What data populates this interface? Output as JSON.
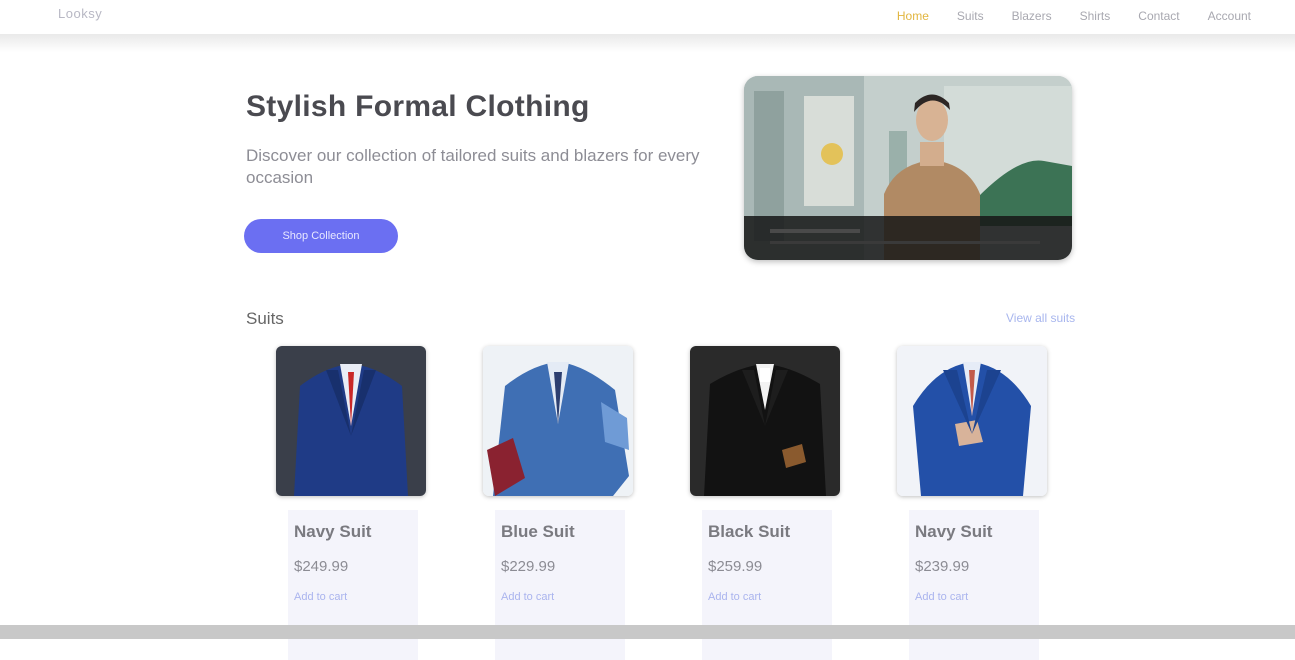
{
  "header": {
    "logo": "Looksy",
    "nav": [
      {
        "label": "Home",
        "active": true
      },
      {
        "label": "Suits",
        "active": false
      },
      {
        "label": "Blazers",
        "active": false
      },
      {
        "label": "Shirts",
        "active": false
      },
      {
        "label": "Contact",
        "active": false
      },
      {
        "label": "Account",
        "active": false
      }
    ],
    "accent_color": "#e2b640"
  },
  "hero": {
    "title": "Stylish Formal Clothing",
    "subtitle": "Discover our collection of tailored suits and blazers for every occasion",
    "cta_label": "Shop Collection",
    "cta_color": "#6b6ff2",
    "video_icon": "play-video-icon"
  },
  "featured": {
    "title": "Suits",
    "view_all": "View all suits",
    "products": [
      {
        "name": "Navy Suit",
        "price": "$249.99",
        "action": "Add to cart",
        "color": "#1f3b86"
      },
      {
        "name": "Blue Suit",
        "price": "$229.99",
        "action": "Add to cart",
        "color": "#3f6fb4"
      },
      {
        "name": "Black Suit",
        "price": "$259.99",
        "action": "Add to cart",
        "color": "#1a1a1a"
      },
      {
        "name": "Navy Suit",
        "price": "$239.99",
        "action": "Add to cart",
        "color": "#2350a8"
      }
    ]
  }
}
